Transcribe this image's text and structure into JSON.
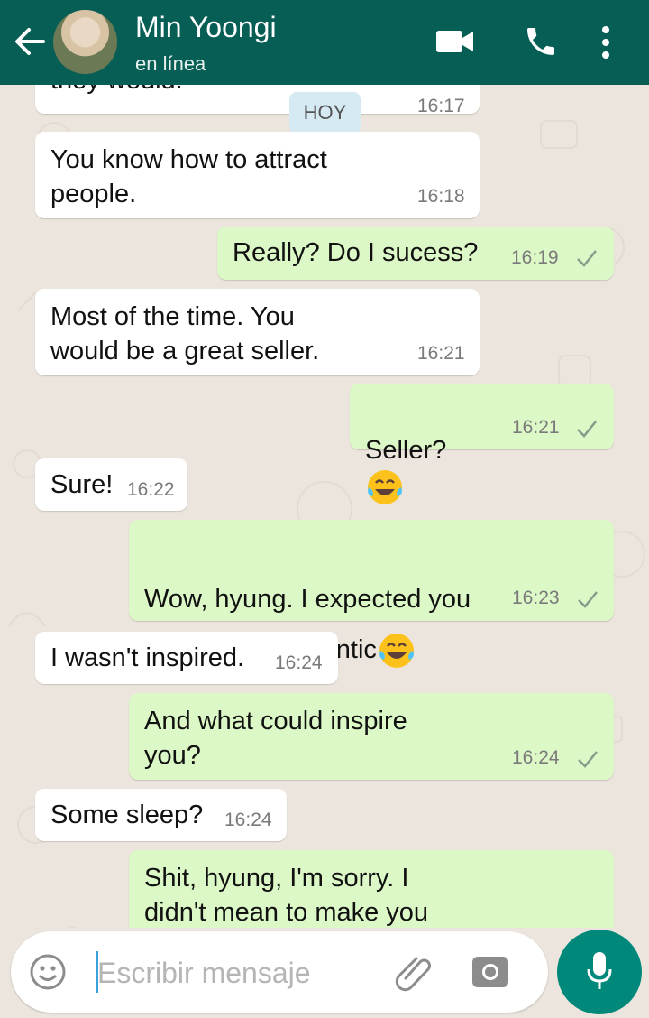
{
  "header": {
    "contact_name": "Min Yoongi",
    "status": "en línea",
    "icons": [
      "back-arrow-icon",
      "video-call-icon",
      "phone-icon",
      "more-vert-icon"
    ]
  },
  "chat": {
    "day_label": "HOY",
    "messages": [
      {
        "dir": "in",
        "text": "they would.",
        "time": "16:17"
      },
      {
        "dir": "in",
        "text": "You know how to attract\npeople.",
        "time": "16:18"
      },
      {
        "dir": "out",
        "text": "Really? Do I sucess?",
        "time": "16:19",
        "read": true
      },
      {
        "dir": "in",
        "text": "Most of the time. You\nwould be a great seller.",
        "time": "16:21"
      },
      {
        "dir": "out",
        "text": "Seller?",
        "time": "16:21",
        "emoji": "tears-of-joy-emoji",
        "read": true
      },
      {
        "dir": "in",
        "text": "Sure!",
        "time": "16:22"
      },
      {
        "dir": "out",
        "text": "Wow, hyung. I expected you\nto be more romantic",
        "time": "16:23",
        "emoji": "tears-of-joy-emoji",
        "read": true
      },
      {
        "dir": "in",
        "text": "I wasn't inspired.",
        "time": "16:24"
      },
      {
        "dir": "out",
        "text": "And what could inspire\nyou?",
        "time": "16:24",
        "read": true
      },
      {
        "dir": "in",
        "text": "Some sleep?",
        "time": "16:24"
      },
      {
        "dir": "out",
        "text": "Shit, hyung, I'm sorry. I\ndidn't mean to make you",
        "time": ""
      }
    ]
  },
  "composer": {
    "placeholder": "Escribir mensaje",
    "icons": [
      "emoji-icon",
      "attach-icon",
      "camera-icon",
      "mic-icon"
    ]
  },
  "colors": {
    "header": "#075e54",
    "outgoing_bubble": "#dcf8c6",
    "incoming_bubble": "#ffffff",
    "mic_button": "#00897b"
  }
}
